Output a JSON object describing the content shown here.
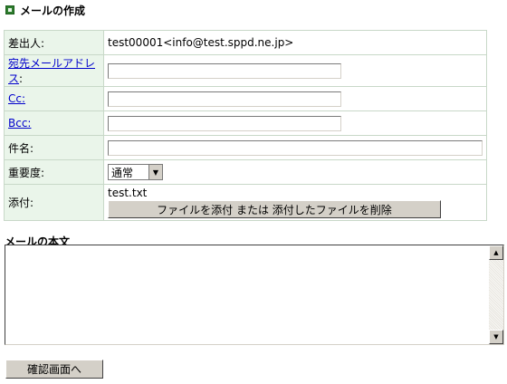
{
  "page": {
    "title": "メールの作成"
  },
  "form": {
    "sender_label": "差出人:",
    "sender_value": "test00001<info@test.sppd.ne.jp>",
    "to_label": "宛先メールアドレス",
    "to_colon": ":",
    "to_value": "",
    "cc_label": "Cc:",
    "cc_value": "",
    "bcc_label": "Bcc:",
    "bcc_value": "",
    "subject_label": "件名:",
    "subject_value": "",
    "priority_label": "重要度:",
    "priority_value": "通常",
    "attach_label": "添付:",
    "attach_file": "test.txt",
    "attach_button": "ファイルを添付 または 添付したファイルを削除"
  },
  "body": {
    "label": "メールの本文",
    "value": ""
  },
  "actions": {
    "confirm": "確認画面へ"
  },
  "colors": {
    "label_bg": "#eaf5ea",
    "link": "#0000cc",
    "icon": "#2e7d2e"
  }
}
